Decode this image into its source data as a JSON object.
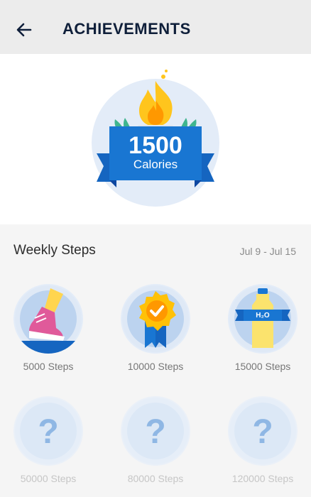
{
  "header": {
    "title": "ACHIEVEMENTS",
    "back_icon": "arrow-left-icon"
  },
  "hero": {
    "value": "1500",
    "unit": "Calories",
    "icon": "flame-trophy-icon"
  },
  "weekly": {
    "title": "Weekly Steps",
    "range": "Jul 9 - Jul 15",
    "badges": [
      {
        "label": "5000 Steps",
        "icon": "sneaker-icon",
        "unlocked": true
      },
      {
        "label": "10000 Steps",
        "icon": "award-ribbon-icon",
        "unlocked": true
      },
      {
        "label": "15000 Steps",
        "icon": "water-bottle-icon",
        "unlocked": true
      },
      {
        "label": "50000 Steps",
        "icon": "question-icon",
        "unlocked": false
      },
      {
        "label": "80000 Steps",
        "icon": "question-icon",
        "unlocked": false
      },
      {
        "label": "120000 Steps",
        "icon": "question-icon",
        "unlocked": false
      }
    ],
    "bottle_text": "H₂O"
  }
}
